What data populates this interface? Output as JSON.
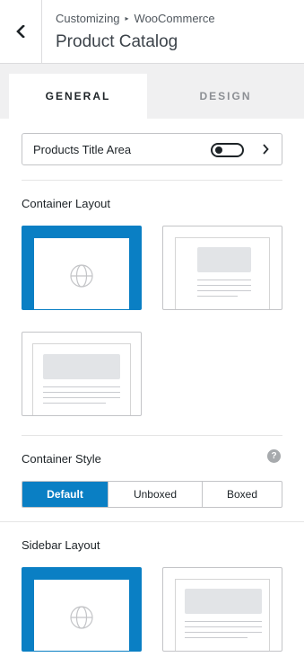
{
  "header": {
    "back_icon": "chevron-left-icon",
    "breadcrumb": [
      "Customizing",
      "WooCommerce"
    ],
    "breadcrumb_separator": "▸",
    "title": "Product Catalog"
  },
  "tabs": [
    {
      "label": "GENERAL",
      "active": true
    },
    {
      "label": "DESIGN",
      "active": false
    }
  ],
  "products_title_area": {
    "label": "Products Title Area",
    "toggle_on": false,
    "chevron_icon": "chevron-right-icon"
  },
  "container_layout": {
    "label": "Container Layout",
    "options": [
      {
        "name": "full-width",
        "selected": true
      },
      {
        "name": "boxed",
        "selected": false
      },
      {
        "name": "contained",
        "selected": false
      }
    ]
  },
  "container_style": {
    "label": "Container Style",
    "help_icon": "?",
    "options": [
      "Default",
      "Unboxed",
      "Boxed"
    ],
    "selected": "Default"
  },
  "sidebar_layout": {
    "label": "Sidebar Layout",
    "options": [
      {
        "name": "default",
        "selected": true
      },
      {
        "name": "no-sidebar",
        "selected": false
      }
    ]
  },
  "colors": {
    "accent": "#0a7fc4",
    "border": "#c3c4c7",
    "tab_bg": "#f0f0f1",
    "placeholder": "#e2e4e7"
  }
}
